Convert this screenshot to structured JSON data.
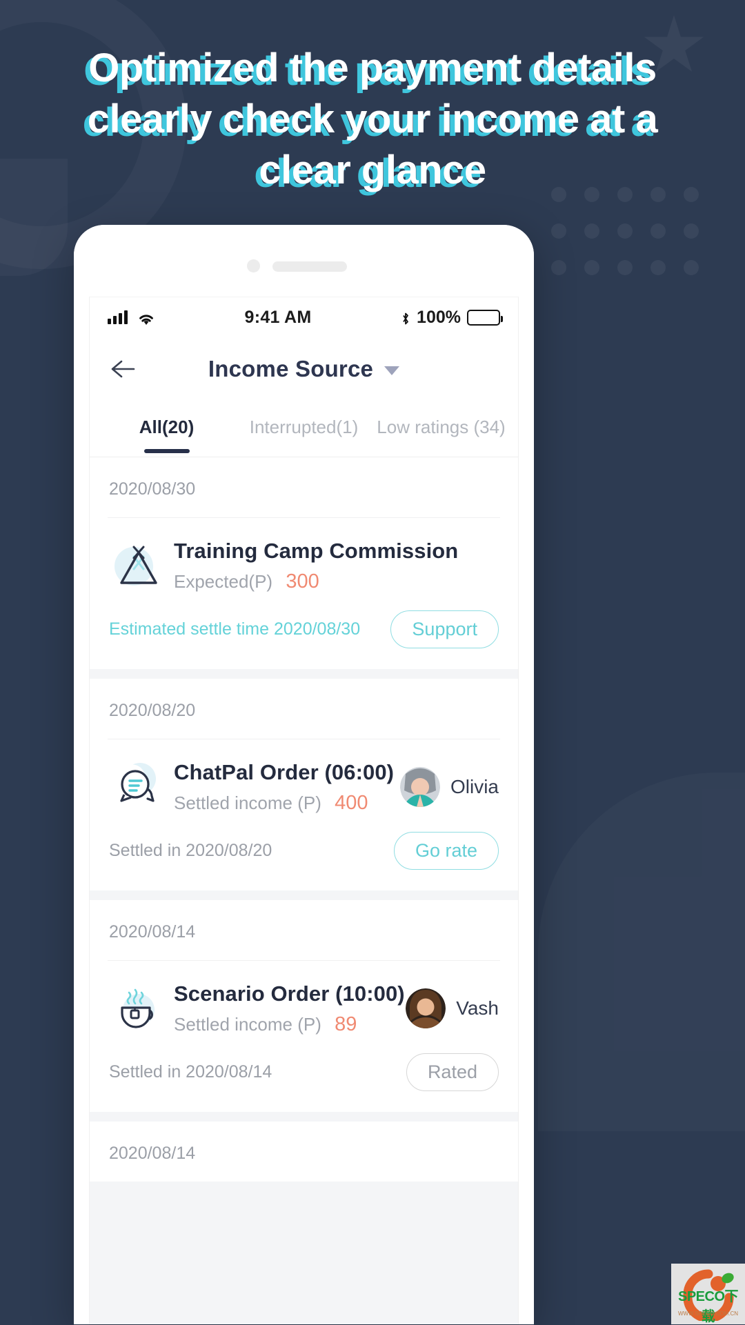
{
  "headline": {
    "lines": [
      "Optimized the payment details",
      "clearly check your income at a",
      "clear glance"
    ]
  },
  "statusbar": {
    "time": "9:41 AM",
    "battery_percent": "100%",
    "signal_icon": "cellular-signal-icon",
    "wifi_icon": "wifi-icon",
    "bluetooth_icon": "bluetooth-icon",
    "battery_icon": "battery-full-icon"
  },
  "navbar": {
    "back_icon": "back-arrow-icon",
    "title": "Income Source",
    "dropdown_icon": "caret-down-icon"
  },
  "tabs": [
    {
      "label": "All(20)",
      "active": true
    },
    {
      "label": "Interrupted(1)",
      "active": false
    },
    {
      "label": "Low ratings (34)",
      "active": false
    }
  ],
  "cards": [
    {
      "date": "2020/08/30",
      "icon": "tent-icon",
      "title": "Training Camp Commission",
      "sub_label": "Expected(P)",
      "amount": "300",
      "person": "",
      "foot_text": "Estimated settle time 2020/08/30",
      "foot_accent": true,
      "button": "Support",
      "button_muted": false
    },
    {
      "date": "2020/08/20",
      "icon": "chat-bubble-icon",
      "title": "ChatPal Order (06:00)",
      "sub_label": "Settled income (P)",
      "amount": "400",
      "person": "Olivia",
      "foot_text": "Settled in 2020/08/20",
      "foot_accent": false,
      "button": "Go rate",
      "button_muted": false
    },
    {
      "date": "2020/08/14",
      "icon": "coffee-cup-icon",
      "title": "Scenario Order (10:00)",
      "sub_label": "Settled income (P)",
      "amount": "89",
      "person": "Vash",
      "foot_text": "Settled in 2020/08/14",
      "foot_accent": false,
      "button": "Rated",
      "button_muted": true
    },
    {
      "date": "2020/08/14",
      "icon": "",
      "title": "",
      "sub_label": "",
      "amount": "",
      "person": "",
      "foot_text": "",
      "foot_accent": false,
      "button": "",
      "button_muted": false
    }
  ],
  "watermark": {
    "text": "SPECO下载",
    "url": "WWW.SPECO.COM.CN"
  },
  "colors": {
    "background": "#2d3b52",
    "accent_cyan": "#3fc6dd",
    "amount_orange": "#f08a72",
    "title_dark": "#242b3e",
    "muted_gray": "#9b9fa7"
  }
}
